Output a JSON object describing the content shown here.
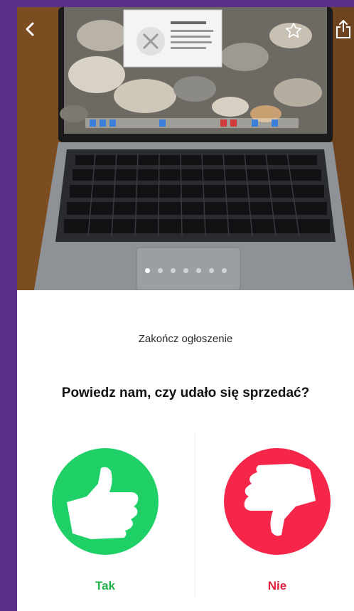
{
  "header": {
    "back_icon": "chevron-left-icon",
    "favorite_icon": "star-outline-icon",
    "share_icon": "share-icon"
  },
  "gallery": {
    "photo_count": 7,
    "active_index": 0
  },
  "sheet": {
    "title": "Zakończ ogłoszenie",
    "question": "Powiedz nam, czy udało się sprzedać?",
    "yes_label": "Tak",
    "no_label": "Nie",
    "yes_icon": "thumbs-up-icon",
    "no_icon": "thumbs-down-icon"
  },
  "colors": {
    "background": "#5a2f8c",
    "yes": "#1fd067",
    "no": "#f5264a",
    "yes_text": "#24b24b",
    "no_text": "#e0223f"
  }
}
